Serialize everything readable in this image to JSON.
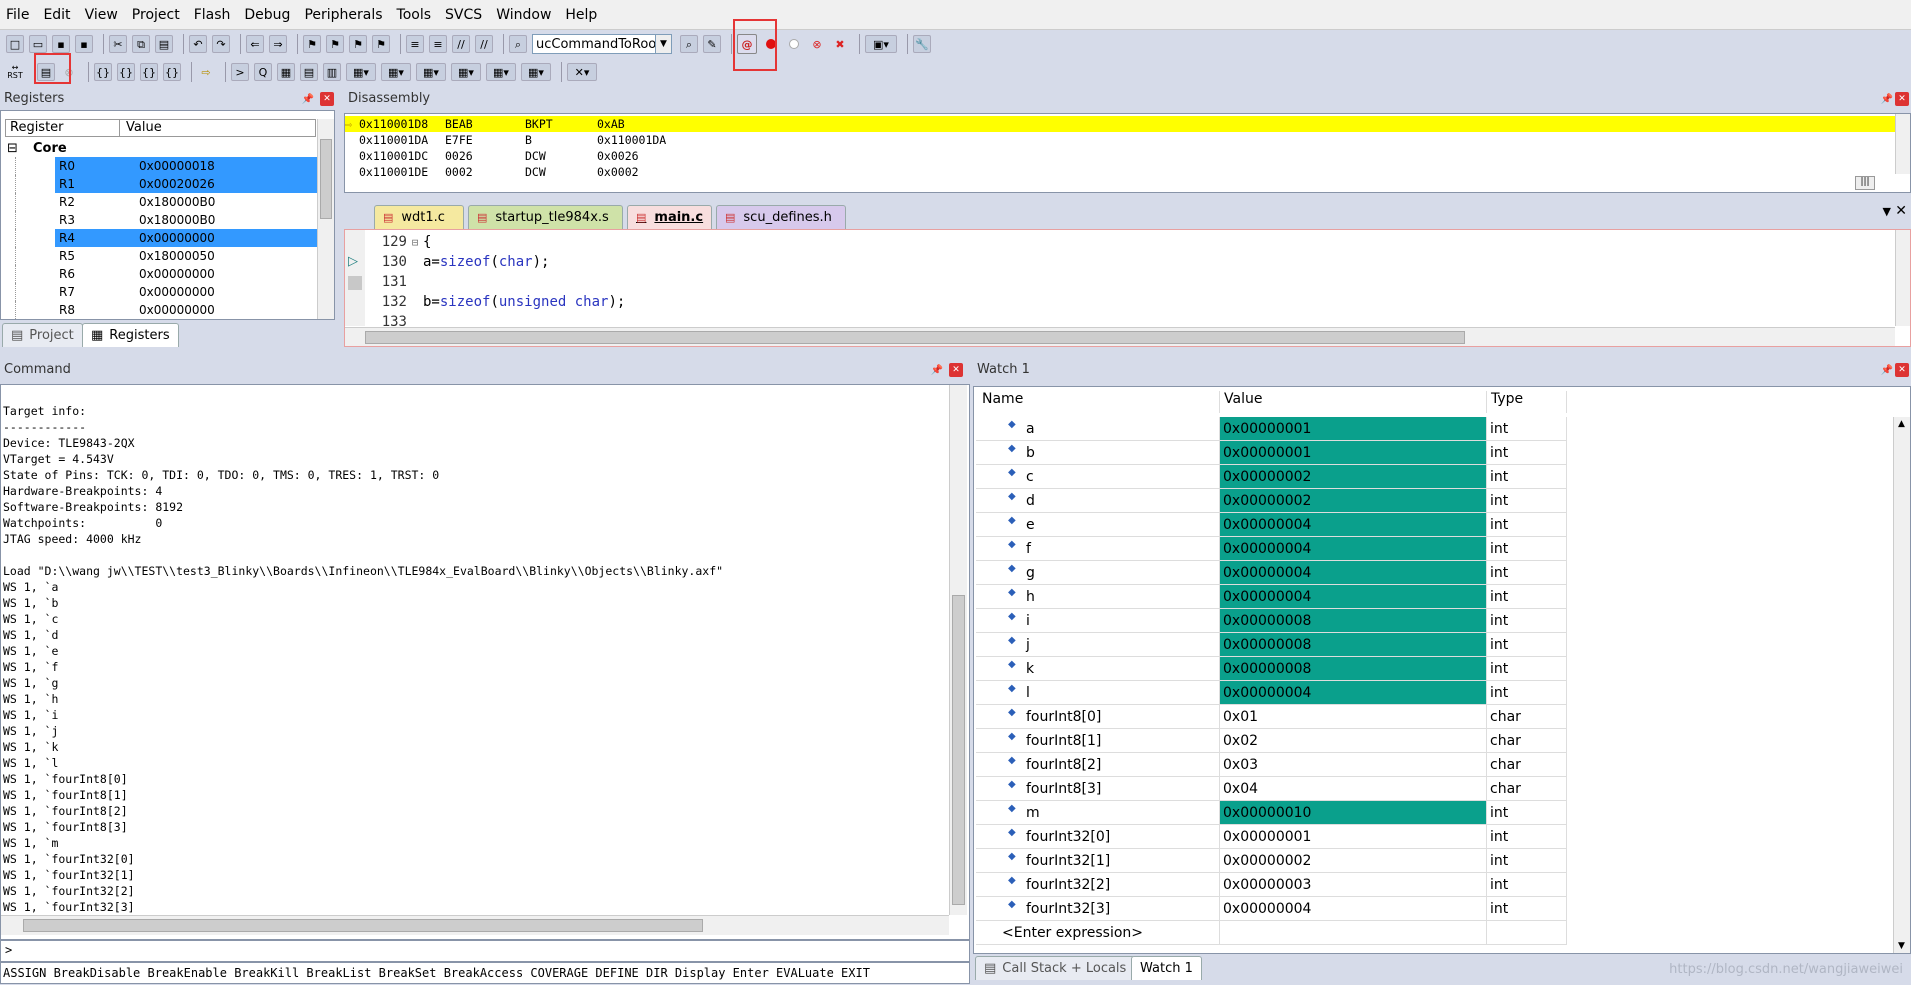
{
  "menu": [
    "File",
    "Edit",
    "View",
    "Project",
    "Flash",
    "Debug",
    "Peripherals",
    "Tools",
    "SVCS",
    "Window",
    "Help"
  ],
  "toolbar": {
    "target_combo": "ucCommandToRoof",
    "rst_label": "RST"
  },
  "registers": {
    "title": "Registers",
    "col_register": "Register",
    "col_value": "Value",
    "group": "Core",
    "rows": [
      {
        "name": "R0",
        "value": "0x00000018",
        "selected": true
      },
      {
        "name": "R1",
        "value": "0x00020026",
        "selected": true
      },
      {
        "name": "R2",
        "value": "0x180000B0",
        "selected": false
      },
      {
        "name": "R3",
        "value": "0x180000B0",
        "selected": false
      },
      {
        "name": "R4",
        "value": "0x00000000",
        "selected": true
      },
      {
        "name": "R5",
        "value": "0x18000050",
        "selected": false
      },
      {
        "name": "R6",
        "value": "0x00000000",
        "selected": false
      },
      {
        "name": "R7",
        "value": "0x00000000",
        "selected": false
      },
      {
        "name": "R8",
        "value": "0x00000000",
        "selected": false
      }
    ],
    "tab_project": "Project",
    "tab_registers": "Registers"
  },
  "disassembly": {
    "title": "Disassembly",
    "lines": [
      {
        "addr": "0x110001D8",
        "hex": "BEAB",
        "op": "BKPT",
        "arg": "0xAB",
        "current": true
      },
      {
        "addr": "0x110001DA",
        "hex": "E7FE",
        "op": "B",
        "arg": "0x110001DA",
        "current": false
      },
      {
        "addr": "0x110001DC",
        "hex": "0026",
        "op": "DCW",
        "arg": "0x0026",
        "current": false
      },
      {
        "addr": "0x110001DE",
        "hex": "0002",
        "op": "DCW",
        "arg": "0x0002",
        "current": false
      }
    ]
  },
  "editor": {
    "tabs": [
      {
        "label": "wdt1.c",
        "bg": "#f5e9a0"
      },
      {
        "label": "startup_tle984x.s",
        "bg": "#cfe2a8"
      },
      {
        "label": "main.c",
        "bg": "#f8dede",
        "active": true
      },
      {
        "label": "scu_defines.h",
        "bg": "#d7c9ec"
      }
    ],
    "lines": [
      {
        "num": "129",
        "fold": "⊟",
        "parts": [
          {
            "t": "{",
            "c": "#000"
          }
        ]
      },
      {
        "num": "130",
        "parts": [
          {
            "t": "a=",
            "c": "#000"
          },
          {
            "t": "sizeof",
            "c": "#2a35c0"
          },
          {
            "t": "(",
            "c": "#000"
          },
          {
            "t": "char",
            "c": "#2a35c0"
          },
          {
            "t": ");",
            "c": "#000"
          }
        ]
      },
      {
        "num": "131",
        "parts": []
      },
      {
        "num": "132",
        "parts": [
          {
            "t": "b=",
            "c": "#000"
          },
          {
            "t": "sizeof",
            "c": "#2a35c0"
          },
          {
            "t": "(",
            "c": "#000"
          },
          {
            "t": "unsigned char",
            "c": "#2a35c0"
          },
          {
            "t": ");",
            "c": "#000"
          }
        ]
      },
      {
        "num": "133",
        "parts": []
      }
    ]
  },
  "command": {
    "title": "Command",
    "lines": [
      "",
      "Target info:",
      "------------",
      "Device: TLE9843-2QX",
      "VTarget = 4.543V",
      "State of Pins: TCK: 0, TDI: 0, TDO: 0, TMS: 0, TRES: 1, TRST: 0",
      "Hardware-Breakpoints: 4",
      "Software-Breakpoints: 8192",
      "Watchpoints:          0",
      "JTAG speed: 4000 kHz",
      "",
      "Load \"D:\\\\wang jw\\\\TEST\\\\test3_Blinky\\\\Boards\\\\Infineon\\\\TLE984x_EvalBoard\\\\Blinky\\\\Objects\\\\Blinky.axf\"",
      "WS 1, `a",
      "WS 1, `b",
      "WS 1, `c",
      "WS 1, `d",
      "WS 1, `e",
      "WS 1, `f",
      "WS 1, `g",
      "WS 1, `h",
      "WS 1, `i",
      "WS 1, `j",
      "WS 1, `k",
      "WS 1, `l",
      "WS 1, `fourInt8[0]",
      "WS 1, `fourInt8[1]",
      "WS 1, `fourInt8[2]",
      "WS 1, `fourInt8[3]",
      "WS 1, `m",
      "WS 1, `fourInt32[0]",
      "WS 1, `fourInt32[1]",
      "WS 1, `fourInt32[2]",
      "WS 1, `fourInt32[3]"
    ],
    "prompt": ">",
    "keywords": "ASSIGN BreakDisable BreakEnable BreakKill BreakList BreakSet BreakAccess COVERAGE DEFINE DIR Display Enter EVALuate EXIT"
  },
  "watch": {
    "title": "Watch 1",
    "col_name": "Name",
    "col_value": "Value",
    "col_type": "Type",
    "rows": [
      {
        "name": "a",
        "value": "0x00000001",
        "type": "int",
        "hl": true
      },
      {
        "name": "b",
        "value": "0x00000001",
        "type": "int",
        "hl": true
      },
      {
        "name": "c",
        "value": "0x00000002",
        "type": "int",
        "hl": true
      },
      {
        "name": "d",
        "value": "0x00000002",
        "type": "int",
        "hl": true
      },
      {
        "name": "e",
        "value": "0x00000004",
        "type": "int",
        "hl": true
      },
      {
        "name": "f",
        "value": "0x00000004",
        "type": "int",
        "hl": true
      },
      {
        "name": "g",
        "value": "0x00000004",
        "type": "int",
        "hl": true
      },
      {
        "name": "h",
        "value": "0x00000004",
        "type": "int",
        "hl": true
      },
      {
        "name": "i",
        "value": "0x00000008",
        "type": "int",
        "hl": true
      },
      {
        "name": "j",
        "value": "0x00000008",
        "type": "int",
        "hl": true
      },
      {
        "name": "k",
        "value": "0x00000008",
        "type": "int",
        "hl": true
      },
      {
        "name": "l",
        "value": "0x00000004",
        "type": "int",
        "hl": true
      },
      {
        "name": "fourInt8[0]",
        "value": "0x01",
        "type": "char",
        "hl": false
      },
      {
        "name": "fourInt8[1]",
        "value": "0x02",
        "type": "char",
        "hl": false
      },
      {
        "name": "fourInt8[2]",
        "value": "0x03",
        "type": "char",
        "hl": false
      },
      {
        "name": "fourInt8[3]",
        "value": "0x04",
        "type": "char",
        "hl": false
      },
      {
        "name": "m",
        "value": "0x00000010",
        "type": "int",
        "hl": true
      },
      {
        "name": "fourInt32[0]",
        "value": "0x00000001",
        "type": "int",
        "hl": false
      },
      {
        "name": "fourInt32[1]",
        "value": "0x00000002",
        "type": "int",
        "hl": false
      },
      {
        "name": "fourInt32[2]",
        "value": "0x00000003",
        "type": "int",
        "hl": false
      },
      {
        "name": "fourInt32[3]",
        "value": "0x00000004",
        "type": "int",
        "hl": false
      }
    ],
    "enter_expression": "<Enter expression>",
    "tab_callstack": "Call Stack + Locals",
    "tab_watch": "Watch 1",
    "watermark": "https://blog.csdn.net/wangjiaweiwei"
  },
  "colors": {
    "watch_highlight": "#0aa08c",
    "register_selected": "#3399ff",
    "current_line": "#ffff00",
    "annotation": "#e53535"
  }
}
